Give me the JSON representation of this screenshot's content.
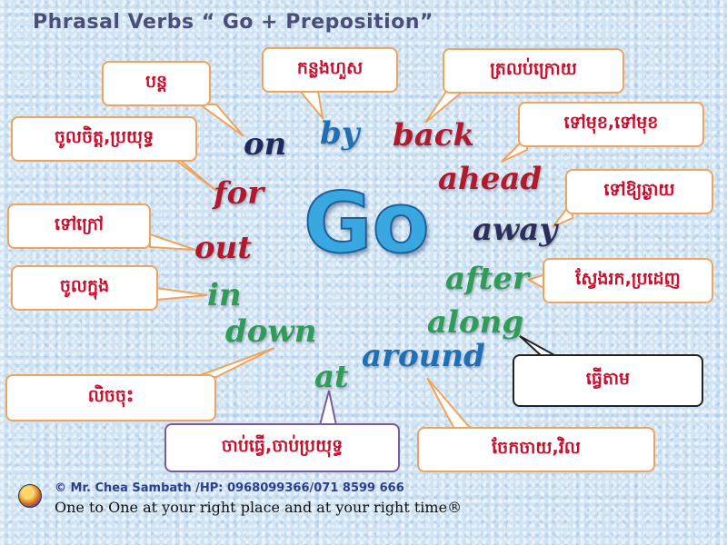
{
  "title": "Phrasal Verbs “ Go + Preposition”",
  "center_word": "Go",
  "words": {
    "on": "on",
    "by": "by",
    "back": "back",
    "ahead": "ahead",
    "for": "for",
    "away": "away",
    "out": "out",
    "after": "after",
    "in": "in",
    "along": "along",
    "down": "down",
    "around": "around",
    "at": "at"
  },
  "meanings": {
    "on": "បន្ត",
    "by": "កន្លងហួស",
    "back": "ត្រលប់ក្រោយ",
    "ahead": "ទៅមុខ,ទៅមុខ",
    "for": "ចូលចិត្ត,ប្រយុទ្ធ",
    "away": "ទៅឱ្យឆ្ងាយ",
    "out": "ទៅក្រៅ",
    "after": "ស្វែងរក,ប្រដេញ",
    "in": "ចូលក្នុង",
    "along": "ធ្វើតាម",
    "down": "លិចចុះ",
    "around": "ចែកចាយ,វិល",
    "at": "ចាប់ធ្វើ,ចាប់ប្រយុទ្ធ"
  },
  "colors": {
    "word_navy": "#1f2a5c",
    "word_blue": "#1f6fb5",
    "word_red": "#b3192c",
    "word_dark": "#2b2f5a",
    "word_green": "#2f9d57",
    "center_blue": "#3aa8e0",
    "bubble_orange_border": "#f0a35c",
    "bubble_purple_border": "#7a5c9b",
    "bubble_black_border": "#222222",
    "khmer_text": "#c8102e"
  },
  "footer": {
    "logo_icon": "school-logo-icon",
    "credit": "© Mr. Chea Sambath /HP: 0968099366/071 8599 666",
    "tagline": "One to One at your right place and at your right time®"
  }
}
